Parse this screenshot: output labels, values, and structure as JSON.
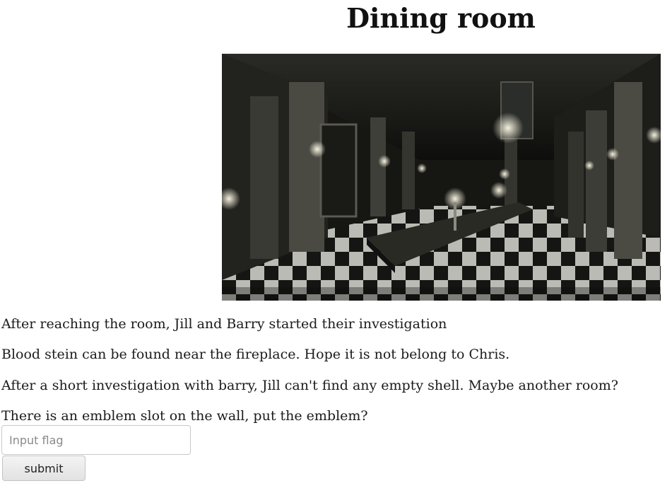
{
  "page": {
    "title": "Dining room"
  },
  "scene_image": {
    "subject": "dining-hall-image"
  },
  "story": {
    "line1": "After reaching the room, Jill and Barry started their investigation",
    "line2": "Blood stein can be found near the fireplace. Hope it is not belong to Chris.",
    "line3": "After a short investigation with barry, Jill can't find any empty shell. Maybe another room?",
    "line4": "There is an emblem slot on the wall, put the emblem?"
  },
  "form": {
    "flag_placeholder": "Input flag",
    "flag_value": "",
    "submit_label": "submit"
  }
}
